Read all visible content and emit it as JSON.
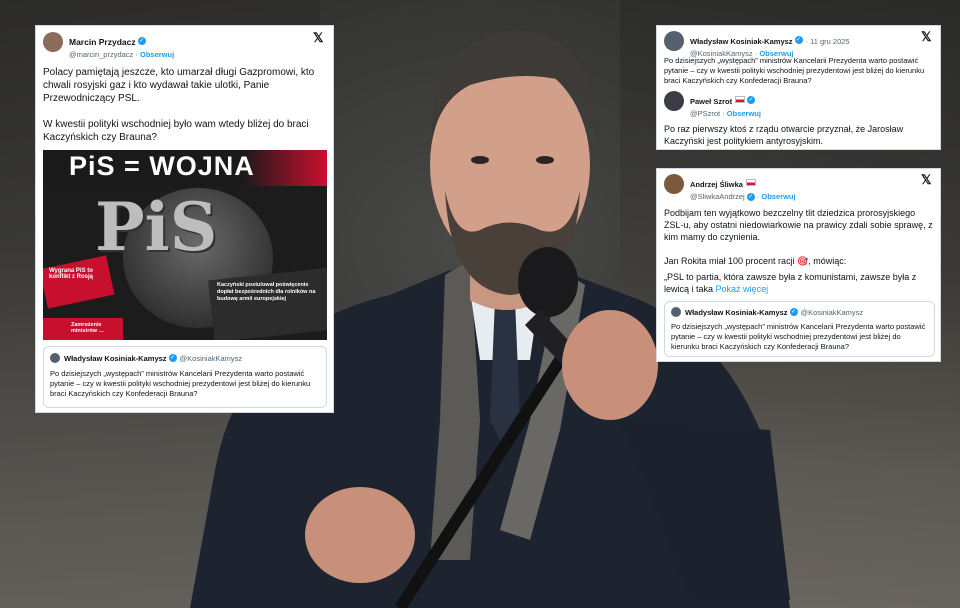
{
  "card1": {
    "name": "Marcin Przydacz",
    "handle": "@marcin_przydacz",
    "follow": "Obserwuj",
    "text1": "Polacy pamiętają jeszcze, kto umarzał długi Gazpromowi, kto chwali rosyjski gaz i kto wydawał takie ulotki, Panie Przewodniczący PSL.",
    "text2": "W kwestii polityki wschodniej było wam wtedy bliżej do braci Kaczyńskich czy Brauna?",
    "poster_title": "PiS = WOJNA",
    "poster_logo": "PiS",
    "poster_small1": "Wygrana PiS to konflikt z Rosją",
    "poster_small2": "Kaczyński postulował poświęcenie dopłat bezpośrednich dla rolników na budowę armii europejskiej",
    "poster_small3": "Zamrożenie ministrów …",
    "quote_name": "Władysław Kosiniak-Kamysz",
    "quote_handle": "@KosiniakKamysz",
    "quote_text": "Po dzisiejszych „występach” ministrów Kancelarii Prezydenta warto postawić pytanie – czy w kwestii polityki wschodniej prezydentowi jest bliżej do kierunku braci Kaczyńskich czy Konfederacji Brauna?"
  },
  "card2": {
    "name": "Władysław Kosiniak-Kamysz",
    "date": "· 11 gru 2025",
    "handle": "@KosiniakKamysz",
    "follow": "Obserwuj",
    "quote_text": "Po dzisiejszych „występach” ministrów Kancelarii Prezydenta warto postawić pytanie – czy w kwestii polityki wschodniej prezydentowi jest bliżej do kierunku braci Kaczyńskich czy Konfederacji Brauna?",
    "reply_name": "Paweł Szrot",
    "reply_handle": "@PSzrot",
    "reply_follow": "Obserwuj",
    "reply_text": "Po raz pierwszy ktoś z rządu otwarcie przyznał, że Jarosław Kaczyński jest politykiem antyrosyjskim."
  },
  "card3": {
    "name": "Andrzej Śliwka",
    "handle": "@SliwkaAndrzej",
    "follow": "Obserwuj",
    "text1": "Podbijam ten wyjątkowo bezczelny tlit dziedzica prorosyjskiego ZSL-u, aby ostatni niedowiarkowie na prawicy zdali sobie sprawę, z kim mamy do czynienia.",
    "text2": "Jan Rokita miał 100 procent racji 🎯, mówiąc:",
    "text3": "„PSL to partia, która zawsze była z komunistami, zawsze była z lewicą i taka",
    "more": "Pokaż więcej",
    "quote_name": "Władysław Kosiniak-Kamysz",
    "quote_handle": "@KosiniakKamysz",
    "quote_text": "Po dzisiejszych „występach” ministrów Kancelarii Prezydenta warto postawić pytanie – czy w kwestii polityki wschodniej prezydentowi jest bliżej do kierunku braci Kaczyńskich czy Konfederacji Brauna?"
  },
  "icons": {
    "x": "𝕏",
    "verified": "✓"
  },
  "colors": {
    "accent": "#1d9bf0",
    "poster_red": "#c8102e"
  }
}
